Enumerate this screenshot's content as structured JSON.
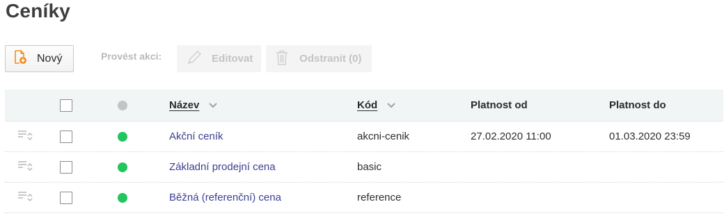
{
  "page": {
    "title": "Ceníky"
  },
  "toolbar": {
    "new_label": "Nový",
    "actions_label": "Provést akci:",
    "edit_label": "Editovat",
    "delete_label": "Odstranit (0)"
  },
  "table": {
    "headers": {
      "name": "Název",
      "code": "Kód",
      "valid_from": "Platnost od",
      "valid_to": "Platnost do"
    },
    "header_status_color": "#c4c4c4",
    "rows": [
      {
        "name": "Akční ceník",
        "code": "akcni-cenik",
        "valid_from": "27.02.2020 11:00",
        "valid_to": "01.03.2020 23:59",
        "status_color": "#22c55e"
      },
      {
        "name": "Základní prodejní cena",
        "code": "basic",
        "valid_from": "",
        "valid_to": "",
        "status_color": "#22c55e"
      },
      {
        "name": "Běžná (referenční) cena",
        "code": "reference",
        "valid_from": "",
        "valid_to": "",
        "status_color": "#22c55e"
      }
    ]
  },
  "colors": {
    "accent_orange": "#f28c1b",
    "link": "#3a3f8f",
    "active_green": "#22c55e"
  },
  "icons": {
    "new": "new-document-icon",
    "edit": "pencil-icon",
    "delete": "trash-icon",
    "sort": "chevron-down-icon",
    "row_handle": "reorder-icon"
  }
}
